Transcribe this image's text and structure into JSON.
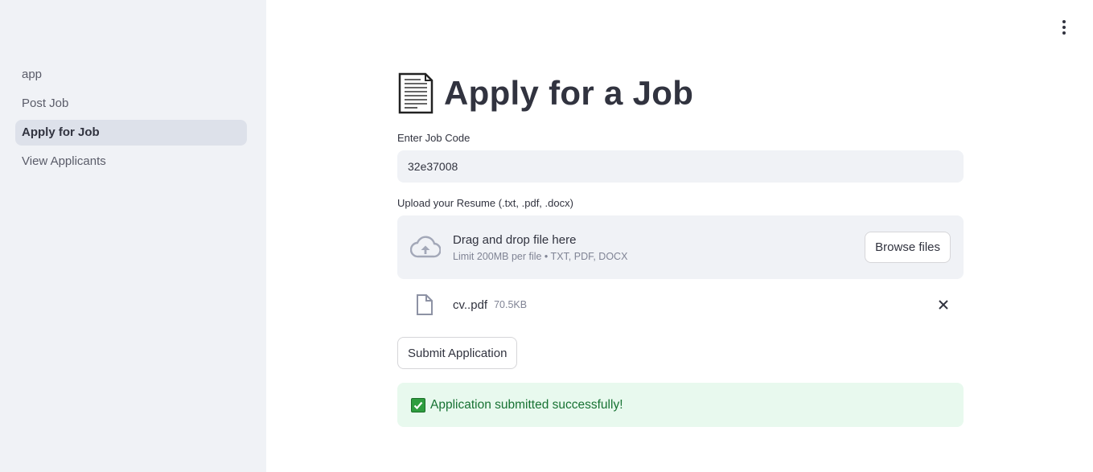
{
  "sidebar": {
    "items": [
      {
        "label": "app",
        "active": false
      },
      {
        "label": "Post Job",
        "active": false
      },
      {
        "label": "Apply for Job",
        "active": true
      },
      {
        "label": "View Applicants",
        "active": false
      }
    ]
  },
  "page": {
    "title": "Apply for a Job",
    "title_icon": "page-document-icon"
  },
  "job_code": {
    "label": "Enter Job Code",
    "value": "32e37008"
  },
  "upload": {
    "label": "Upload your Resume (.txt, .pdf, .docx)",
    "drop_text": "Drag and drop file here",
    "limit_text": "Limit 200MB per file • TXT, PDF, DOCX",
    "browse_label": "Browse files",
    "icon": "cloud-upload-icon"
  },
  "uploaded_file": {
    "name": "cv..pdf",
    "size": "70.5KB",
    "icon": "file-icon"
  },
  "submit": {
    "label": "Submit Application"
  },
  "alert": {
    "text": "Application submitted successfully!",
    "icon": "check-mark-icon"
  },
  "colors": {
    "sidebar_bg": "#f0f2f6",
    "active_item_bg": "#dde1ea",
    "success_bg": "#e8f9ee",
    "success_text": "#177233"
  }
}
